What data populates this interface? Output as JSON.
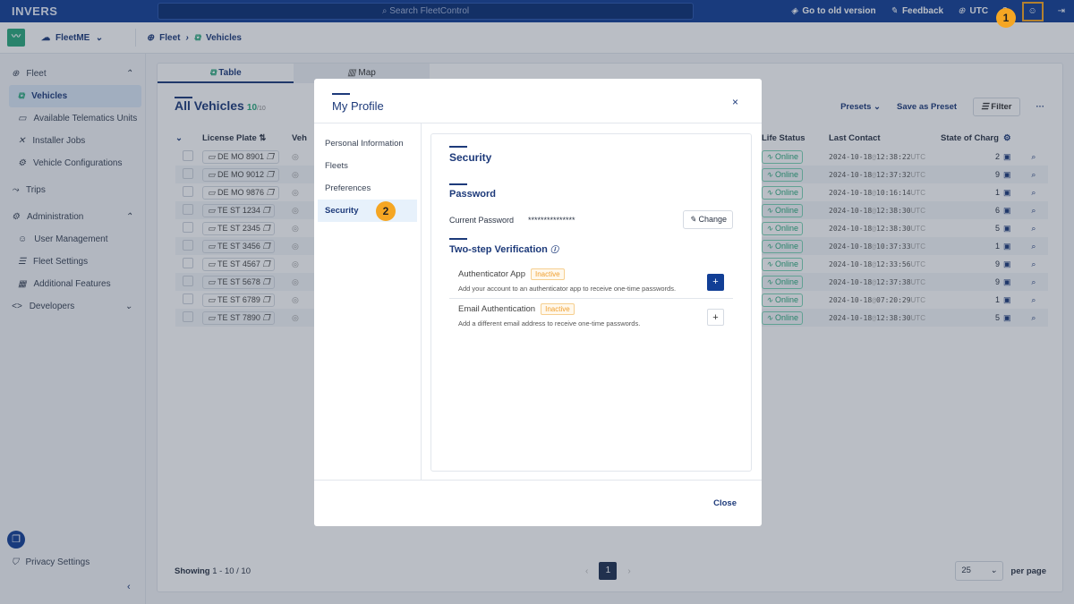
{
  "topbar": {
    "logo": "INVERS",
    "search_placeholder": "Search FleetControl",
    "old_version": "Go to old version",
    "feedback": "Feedback",
    "timezone": "UTC"
  },
  "subbar": {
    "org": "FleetME",
    "breadcrumb": [
      "Fleet",
      "Vehicles"
    ]
  },
  "sidebar": {
    "items": [
      {
        "label": "Fleet",
        "type": "group"
      },
      {
        "label": "Vehicles",
        "active": true
      },
      {
        "label": "Available Telematics Units"
      },
      {
        "label": "Installer Jobs"
      },
      {
        "label": "Vehicle Configurations"
      },
      {
        "label": "Trips",
        "type": "group"
      },
      {
        "label": "Administration",
        "type": "group"
      },
      {
        "label": "User Management"
      },
      {
        "label": "Fleet Settings"
      },
      {
        "label": "Additional Features"
      },
      {
        "label": "Developers",
        "type": "group"
      }
    ],
    "privacy": "Privacy Settings"
  },
  "main": {
    "tabs": [
      "Table",
      "Map"
    ],
    "title": "All Vehicles",
    "count": "10",
    "total": "/10",
    "presets": "Presets",
    "save_preset": "Save as Preset",
    "filter": "Filter",
    "columns": [
      "License Plate",
      "Veh",
      "Life Status",
      "Last Contact",
      "State of Charg"
    ],
    "rows": [
      {
        "plate": "DE MO 8901",
        "status": "Online",
        "date": "2024-10-18",
        "time": "12:38:22",
        "soc": "2"
      },
      {
        "plate": "DE MO 9012",
        "status": "Online",
        "date": "2024-10-18",
        "time": "12:37:32",
        "soc": "9"
      },
      {
        "plate": "DE MO 9876",
        "status": "Online",
        "date": "2024-10-18",
        "time": "10:16:14",
        "soc": "1"
      },
      {
        "plate": "TE ST 1234",
        "status": "Online",
        "date": "2024-10-18",
        "time": "12:38:30",
        "soc": "6"
      },
      {
        "plate": "TE ST 2345",
        "status": "Online",
        "date": "2024-10-18",
        "time": "12:38:30",
        "soc": "5"
      },
      {
        "plate": "TE ST 3456",
        "status": "Online",
        "date": "2024-10-18",
        "time": "10:37:33",
        "soc": "1"
      },
      {
        "plate": "TE ST 4567",
        "status": "Online",
        "date": "2024-10-18",
        "time": "12:33:56",
        "soc": "9"
      },
      {
        "plate": "TE ST 5678",
        "status": "Online",
        "date": "2024-10-18",
        "time": "12:37:38",
        "soc": "9"
      },
      {
        "plate": "TE ST 6789",
        "status": "Online",
        "date": "2024-10-18",
        "time": "07:20:29",
        "soc": "1"
      },
      {
        "plate": "TE ST 7890",
        "status": "Online",
        "date": "2024-10-18",
        "time": "12:38:30",
        "soc": "5"
      }
    ],
    "utc": "UTC",
    "showing_label": "Showing",
    "showing": "1 - 10 / 10",
    "page": "1",
    "per_page_value": "25",
    "per_page": "per page"
  },
  "modal": {
    "title": "My Profile",
    "nav": [
      "Personal Information",
      "Fleets",
      "Preferences",
      "Security"
    ],
    "section": "Security",
    "password_heading": "Password",
    "current_password_label": "Current Password",
    "current_password": "***************",
    "change": "Change",
    "two_step": "Two-step Verification",
    "methods": [
      {
        "name": "Authenticator App",
        "status": "Inactive",
        "desc": "Add your account to an authenticator app to receive one-time passwords."
      },
      {
        "name": "Email Authentication",
        "status": "Inactive",
        "desc": "Add a different email address to receive one-time passwords."
      }
    ],
    "close": "Close"
  },
  "annotations": [
    "1",
    "2"
  ],
  "colors": {
    "brand": "#123f96",
    "accent": "#1d3a7a",
    "online": "#2aa97c",
    "inactive": "#f0a030",
    "marker": "#f5a623"
  }
}
